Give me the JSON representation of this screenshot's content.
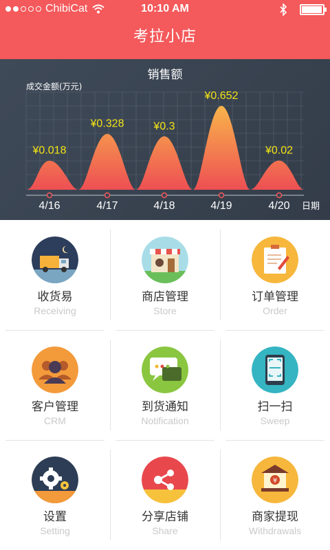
{
  "status_bar": {
    "carrier": "ChibiCat",
    "time": "10:10 AM",
    "signal_bars_filled": 2,
    "signal_bars_total": 5,
    "battery_level": 0.95
  },
  "nav": {
    "title": "考拉小店"
  },
  "chart_data": {
    "type": "area",
    "title": "销售额",
    "ylabel": "成交金额(万元)",
    "xlabel": "日期",
    "categories": [
      "4/16",
      "4/17",
      "4/18",
      "4/19",
      "4/20"
    ],
    "values": [
      0.018,
      0.328,
      0.3,
      0.652,
      0.02
    ],
    "value_labels": [
      "¥0.018",
      "¥0.328",
      "¥0.3",
      "¥0.652",
      "¥0.02"
    ],
    "label_color": "#f5e415",
    "gradient": [
      "#f8b44a",
      "#ee4f53"
    ],
    "grid": true
  },
  "menu": {
    "items": [
      {
        "title": "收货易",
        "sub": "Receiving",
        "icon": "truck-icon"
      },
      {
        "title": "商店管理",
        "sub": "Store",
        "icon": "store-icon"
      },
      {
        "title": "订单管理",
        "sub": "Order",
        "icon": "clipboard-icon"
      },
      {
        "title": "客户管理",
        "sub": "CRM",
        "icon": "people-icon"
      },
      {
        "title": "到货通知",
        "sub": "Notification",
        "icon": "chat-icon"
      },
      {
        "title": "扫一扫",
        "sub": "Sweep",
        "icon": "scan-icon"
      },
      {
        "title": "设置",
        "sub": "Setting",
        "icon": "gear-icon"
      },
      {
        "title": "分享店铺",
        "sub": "Share",
        "icon": "share-icon"
      },
      {
        "title": "商家提现",
        "sub": "Withdrawals",
        "icon": "bank-icon"
      }
    ]
  }
}
